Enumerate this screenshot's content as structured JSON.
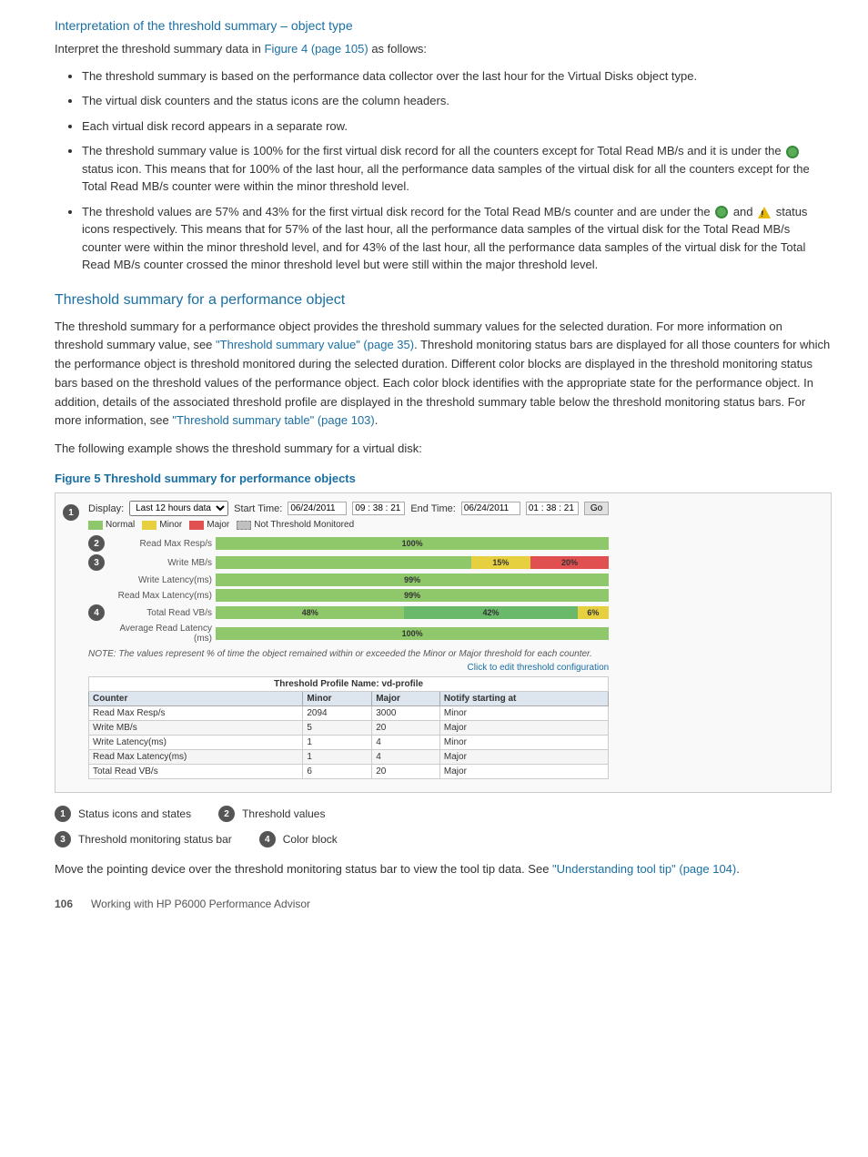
{
  "page": {
    "heading1": "Interpretation of the threshold summary – object type",
    "intro": "Interpret the threshold summary data in Figure 4 (page 105) as follows:",
    "figure4_link": "Figure 4 (page 105)",
    "bullets": [
      "The threshold summary is based on the performance data collector over the last hour for the Virtual Disks object type.",
      "The virtual disk counters and the status icons are the column headers.",
      "Each virtual disk record appears in a separate row.",
      "The threshold summary value is 100% for the first virtual disk record for all the counters except for Total Read MB/s and it is under the  status icon. This means that for 100% of the last hour, all the performance data samples of the virtual disk for all the counters except for the Total Read MB/s counter were within the minor threshold level.",
      "The threshold values are 57% and 43% for the first virtual disk record for the Total Read MB/s counter and are under the  and  status icons respectively. This means that for 57% of the last hour, all the performance data samples of the virtual disk for the Total Read MB/s counter were within the minor threshold level, and for 43% of the last hour, all the performance data samples of the virtual disk for the Total Read MB/s counter crossed the minor threshold level but were still within the major threshold level."
    ],
    "heading2": "Threshold summary for a performance object",
    "body1": "The threshold summary for a performance object provides the threshold summary values for the selected duration. For more information on threshold summary value, see \"Threshold summary value\" (page 35). Threshold monitoring status bars are displayed for all those counters for which the performance object is threshold monitored during the selected duration. Different color blocks are displayed in the threshold monitoring status bars based on the threshold values of the performance object. Each color block identifies with the appropriate state for the performance object. In addition, details of the associated threshold profile are displayed in the threshold summary table below the threshold monitoring status bars. For more information, see \"Threshold summary table\" (page 103).",
    "body1_link1": "\"Threshold summary value\" (page 35)",
    "body1_link2": "\"Threshold summary table\" (page 103)",
    "body2": "The following example shows the threshold summary for a virtual disk:",
    "figure5_caption": "Figure 5 Threshold summary for performance objects",
    "figure": {
      "toolbar": {
        "display_label": "Display:",
        "display_option": "Last 12 hours data",
        "start_label": "Start Time:",
        "start_value": "06/24/2011",
        "end_label": "End Time:",
        "end_value": "06/24/2011",
        "go_button": "Go"
      },
      "legend": {
        "items": [
          {
            "label": "Normal",
            "color": "#8ec86a"
          },
          {
            "label": "Minor",
            "color": "#e6d040"
          },
          {
            "label": "Major",
            "color": "#e05050"
          },
          {
            "label": "Not Threshold Monitored",
            "color": "#c0c0c0"
          }
        ]
      },
      "bars": [
        {
          "label": "Read Max Resp/s",
          "segments": [
            {
              "pct": 100,
              "type": "green",
              "text": "100%"
            }
          ]
        },
        {
          "label": "Write MB/s",
          "segments": [
            {
              "pct": 65,
              "type": "green",
              "text": ""
            },
            {
              "pct": 15,
              "type": "yellow",
              "text": "15%"
            },
            {
              "pct": 20,
              "type": "red",
              "text": "20%"
            }
          ]
        },
        {
          "label": "Write Latency(ms)",
          "segments": [
            {
              "pct": 100,
              "type": "green",
              "text": "99%"
            }
          ]
        },
        {
          "label": "Read Max Latency(ms)",
          "segments": [
            {
              "pct": 100,
              "type": "green",
              "text": "99%"
            }
          ]
        },
        {
          "label": "Total Read VB/s",
          "segments": [
            {
              "pct": 48,
              "type": "green",
              "text": "48%"
            },
            {
              "pct": 44,
              "type": "green",
              "text": "42%"
            },
            {
              "pct": 8,
              "type": "yellow",
              "text": "6%"
            }
          ]
        },
        {
          "label": "Average Read Latency (ms)",
          "segments": [
            {
              "pct": 100,
              "type": "green",
              "text": "100%"
            }
          ]
        }
      ],
      "note": "NOTE: The values represent % of time the object remained within or exceeded the Minor or Major threshold for each counter.",
      "click_link": "Click to edit threshold configuration",
      "table_header": "Threshold Profile Name: vd-profile",
      "table_columns": [
        "Counter",
        "Minor",
        "Major",
        "Notify starting at"
      ],
      "table_rows": [
        {
          "counter": "Read Max Resp/s",
          "minor": "2094",
          "major": "3000",
          "notify": "Minor"
        },
        {
          "counter": "Write MB/s",
          "minor": "5",
          "major": "20",
          "notify": "Major"
        },
        {
          "counter": "Write Latency(ms)",
          "minor": "1",
          "major": "4",
          "notify": "Minor"
        },
        {
          "counter": "Read Max Latency(ms)",
          "minor": "1",
          "major": "4",
          "notify": "Major"
        },
        {
          "counter": "Total Read VB/s",
          "minor": "6",
          "major": "20",
          "notify": "Major"
        }
      ]
    },
    "callouts": [
      {
        "num": "1",
        "label": "Status icons and states"
      },
      {
        "num": "2",
        "label": "Threshold values"
      },
      {
        "num": "3",
        "label": "Threshold monitoring status bar"
      },
      {
        "num": "4",
        "label": "Color block"
      }
    ],
    "footer_text": "Move the pointing device over the threshold monitoring status bar to view the tool tip data. See \"Understanding tool tip\" (page 104).",
    "footer_link": "\"Understanding tool tip\" (page 104)",
    "page_footer": {
      "page_num": "106",
      "description": "Working with HP P6000 Performance Advisor"
    }
  }
}
